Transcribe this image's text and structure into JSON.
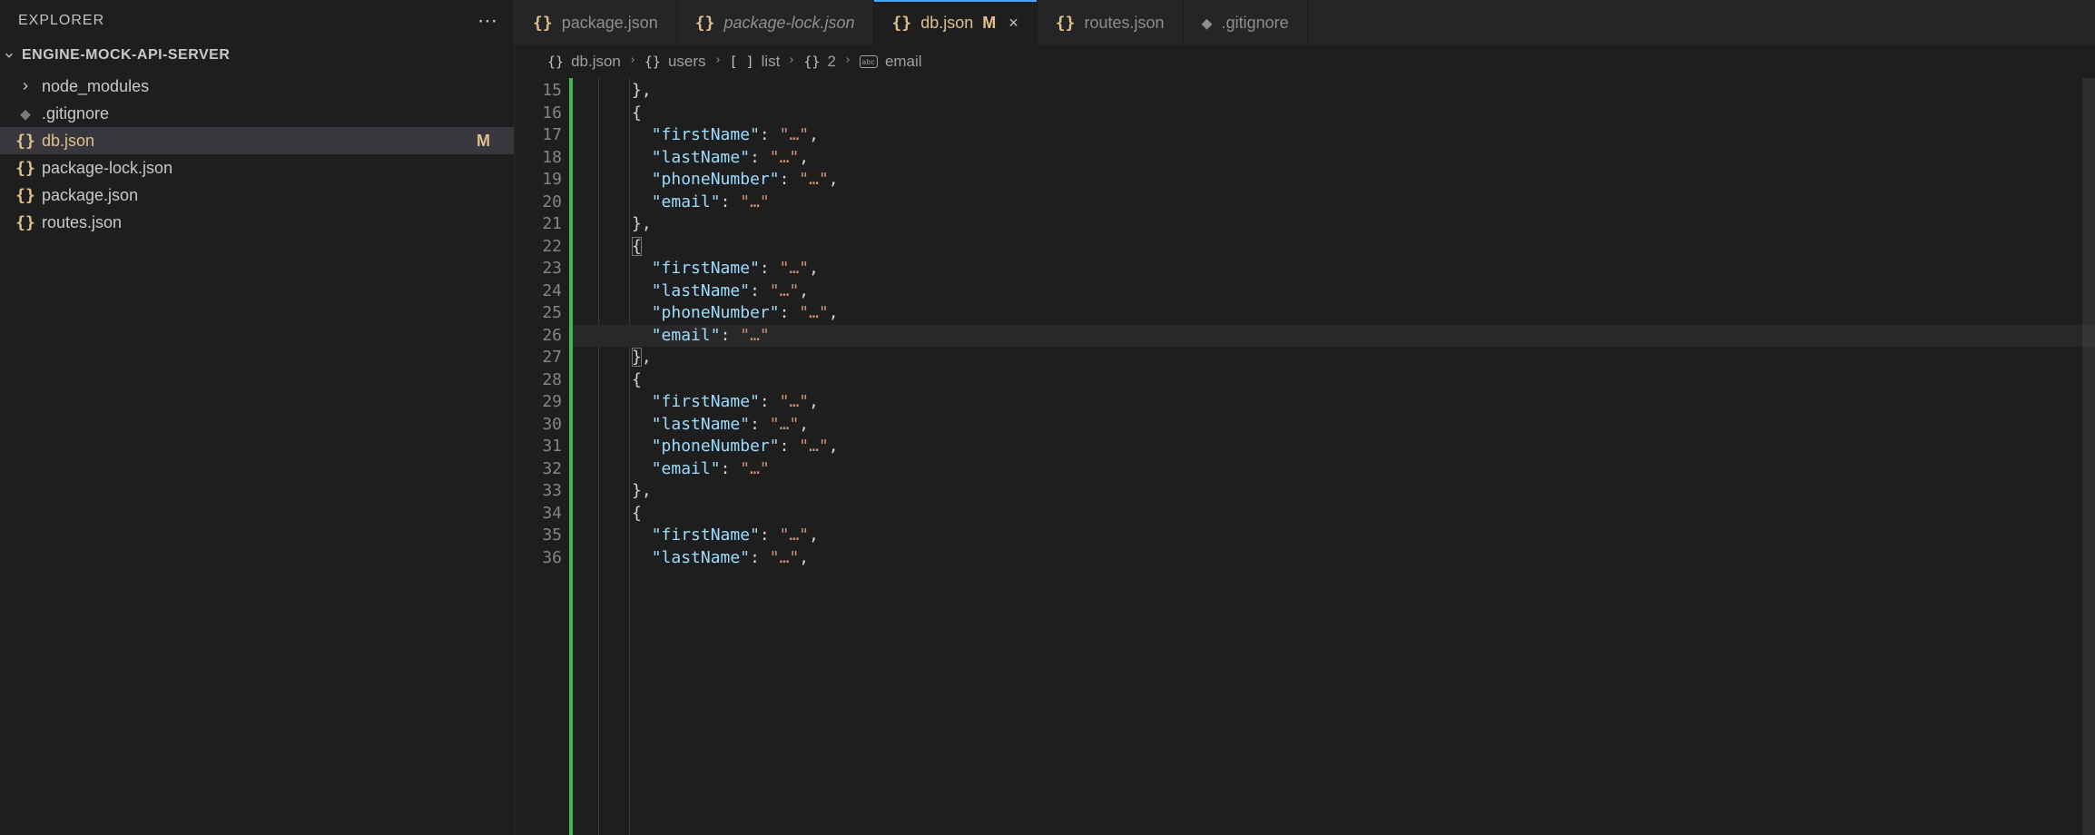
{
  "sidebar": {
    "title": "EXPLORER",
    "project": "ENGINE-MOCK-API-SERVER",
    "files": [
      {
        "icon": "chevron",
        "name": "node_modules",
        "kind": "folder"
      },
      {
        "icon": "git",
        "name": ".gitignore",
        "kind": "file"
      },
      {
        "icon": "json",
        "name": "db.json",
        "kind": "file",
        "modified": true,
        "badge": "M",
        "selected": true
      },
      {
        "icon": "json",
        "name": "package-lock.json",
        "kind": "file"
      },
      {
        "icon": "json",
        "name": "package.json",
        "kind": "file"
      },
      {
        "icon": "json",
        "name": "routes.json",
        "kind": "file"
      }
    ]
  },
  "tabs": [
    {
      "icon": "json",
      "label": "package.json"
    },
    {
      "icon": "json",
      "label": "package-lock.json",
      "italic": true
    },
    {
      "icon": "json",
      "label": "db.json",
      "active": true,
      "modified": true,
      "badge": "M",
      "closeable": true
    },
    {
      "icon": "json",
      "label": "routes.json"
    },
    {
      "icon": "git",
      "label": ".gitignore"
    }
  ],
  "breadcrumb": [
    {
      "iconText": "{}",
      "label": "db.json"
    },
    {
      "iconText": "{}",
      "label": "users"
    },
    {
      "iconText": "[ ]",
      "label": "list"
    },
    {
      "iconText": "{}",
      "label": "2"
    },
    {
      "iconKind": "abc",
      "label": "email"
    }
  ],
  "editor": {
    "startLine": 15,
    "activeLine": 26,
    "lines": [
      "      },",
      "      {",
      "        \"firstName\": \"…\",",
      "        \"lastName\": \"…\",",
      "        \"phoneNumber\": \"…\",",
      "        \"email\": \"…\"",
      "      },",
      "      {",
      "        \"firstName\": \"…\",",
      "        \"lastName\": \"…\",",
      "        \"phoneNumber\": \"…\",",
      "        \"email\": \"…\"",
      "      },",
      "      {",
      "        \"firstName\": \"…\",",
      "        \"lastName\": \"…\",",
      "        \"phoneNumber\": \"…\",",
      "        \"email\": \"…\"",
      "      },",
      "      {",
      "        \"firstName\": \"…\",",
      "        \"lastName\": \"…\","
    ]
  }
}
